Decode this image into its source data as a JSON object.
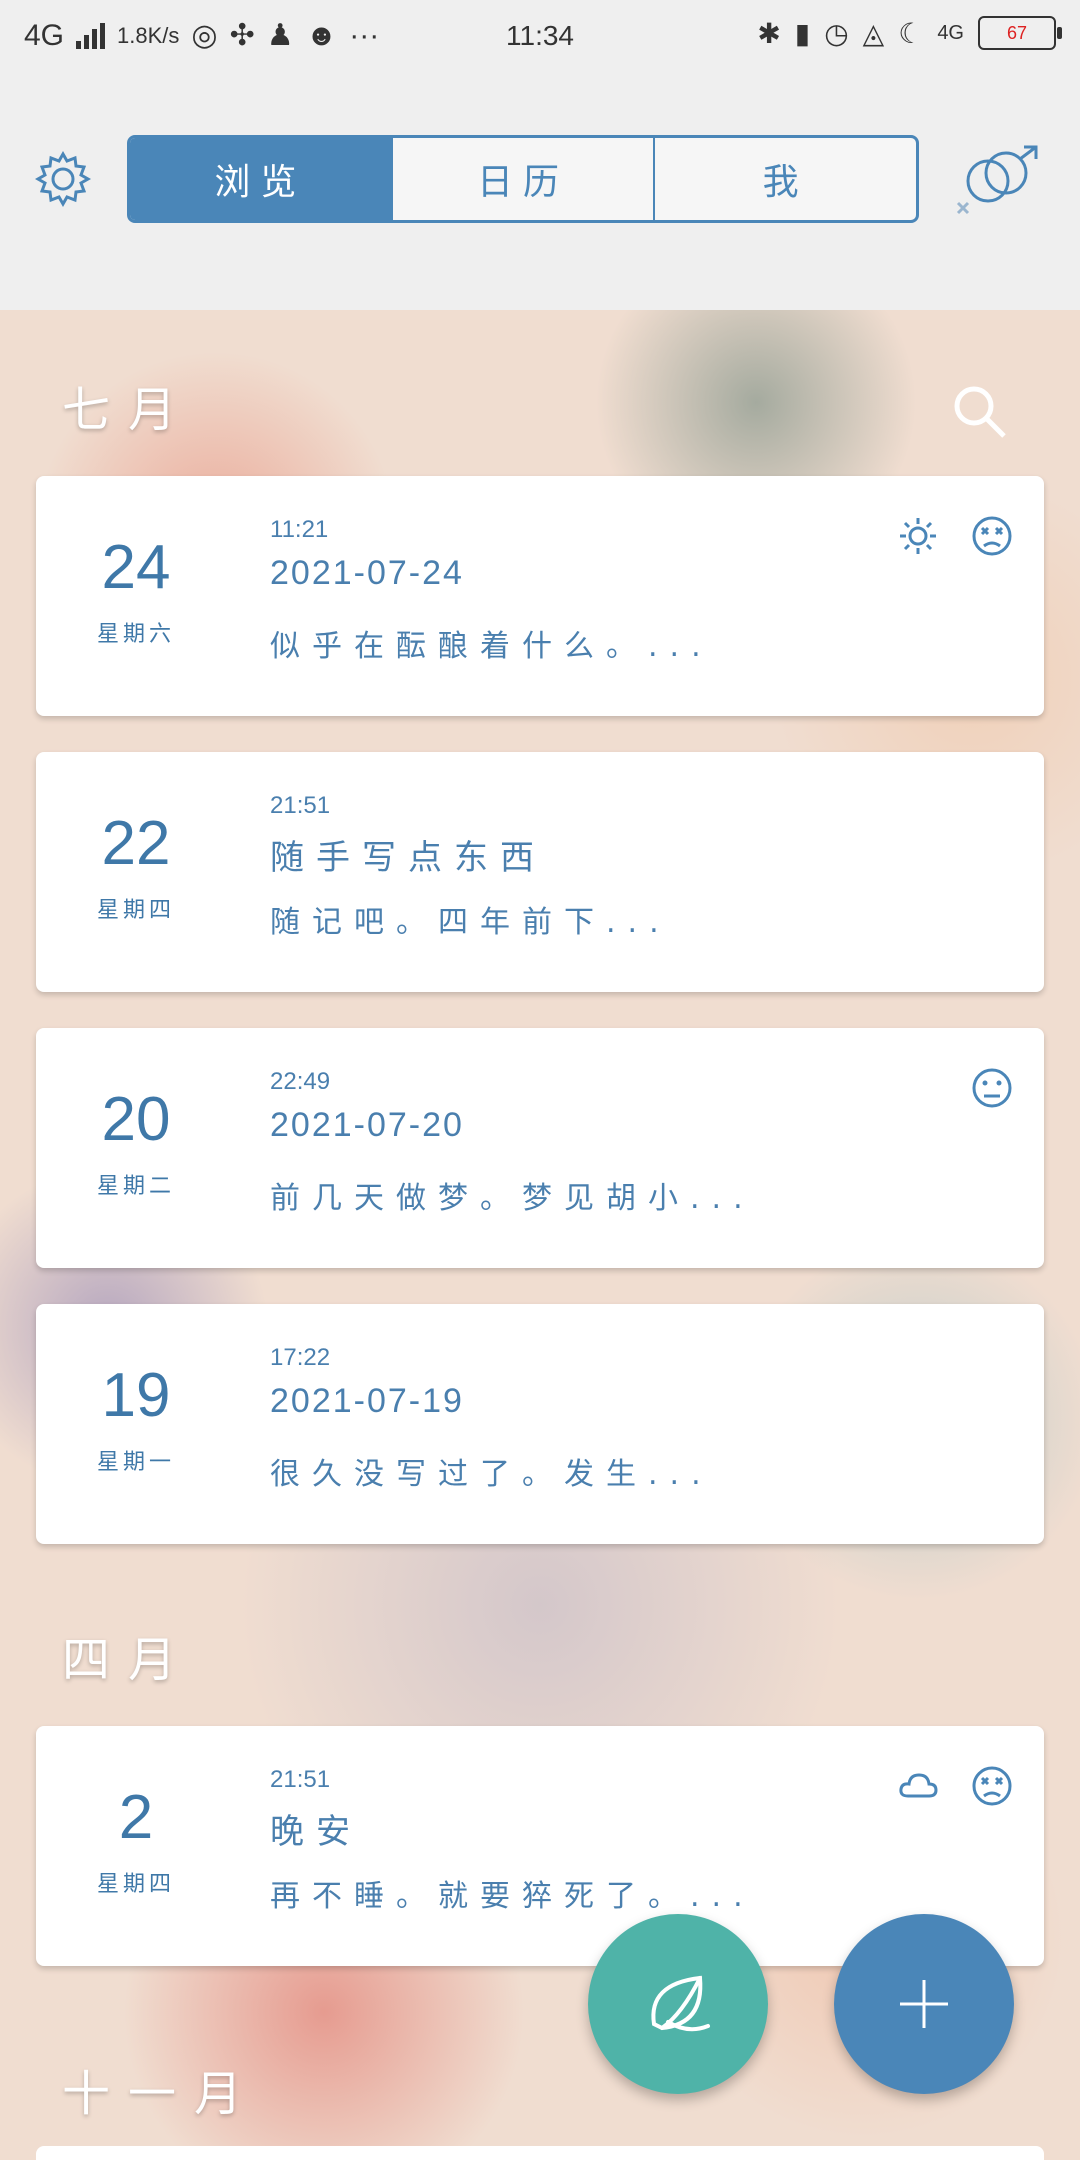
{
  "status_bar": {
    "network": "4G",
    "speed": "1.8K/s",
    "more": "···",
    "time": "11:34",
    "network_right": "4G",
    "battery": "67"
  },
  "tabs": [
    {
      "label": "浏览",
      "active": true
    },
    {
      "label": "日历",
      "active": false
    },
    {
      "label": "我",
      "active": false
    }
  ],
  "months": [
    "七月",
    "四月",
    "十一月"
  ],
  "entries": [
    {
      "day": "24",
      "weekday": "星期六",
      "time": "11:21",
      "title": "2021-07-24",
      "excerpt": "似乎在酝酿着什么。...",
      "icons": [
        "sun-icon",
        "dizzy-face-icon"
      ]
    },
    {
      "day": "22",
      "weekday": "星期四",
      "time": "21:51",
      "title": "随手写点东西",
      "excerpt": "随记吧。四年前下...",
      "icons": []
    },
    {
      "day": "20",
      "weekday": "星期二",
      "time": "22:49",
      "title": "2021-07-20",
      "excerpt": "前几天做梦。梦见胡小...",
      "icons": [
        "neutral-face-icon"
      ]
    },
    {
      "day": "19",
      "weekday": "星期一",
      "time": "17:22",
      "title": "2021-07-19",
      "excerpt": "很久没写过了。发生...",
      "icons": []
    },
    {
      "day": "2",
      "weekday": "星期四",
      "time": "21:51",
      "title": "晚安",
      "excerpt": "再不睡。就要猝死了。...",
      "icons": [
        "cloud-icon",
        "dizzy-face-icon"
      ]
    }
  ],
  "colors": {
    "accent": "#4a86b8",
    "teal": "#4fb3a8"
  }
}
